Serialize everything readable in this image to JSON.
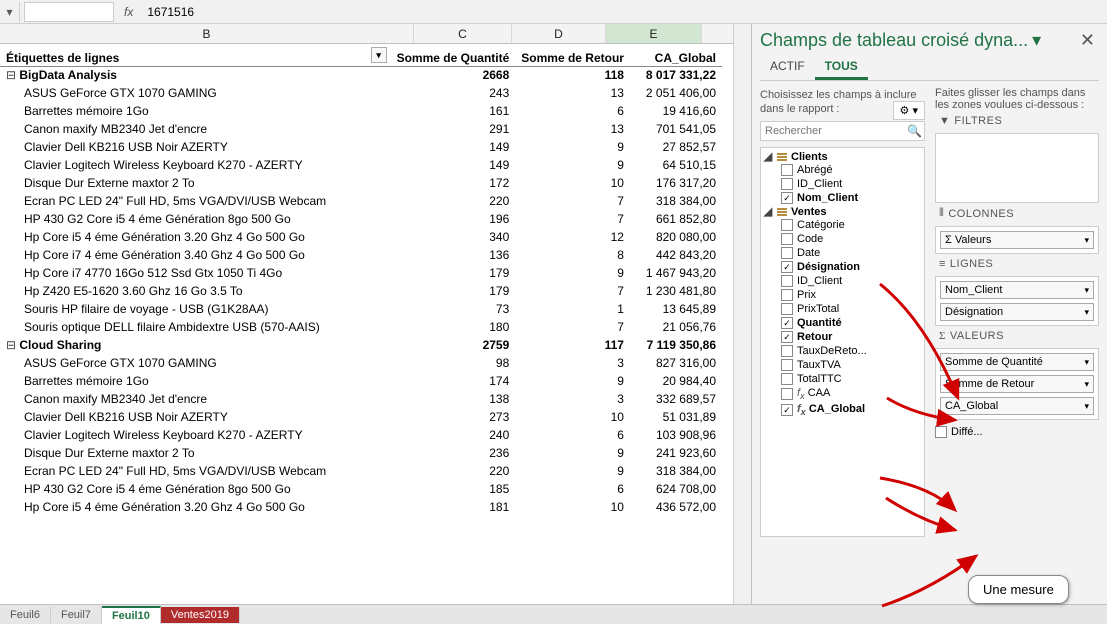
{
  "formula_bar": {
    "cell_ref": "",
    "fx_symbol": "fx",
    "value": "1671516"
  },
  "columns": [
    "B",
    "C",
    "D",
    "E"
  ],
  "headers": {
    "row_labels": "Étiquettes de lignes",
    "c": "Somme de Quantité",
    "d": "Somme de Retour",
    "e": "CA_Global"
  },
  "groups": [
    {
      "label": "BigData Analysis",
      "c": "2668",
      "d": "118",
      "e": "8 017 331,22",
      "rows": [
        {
          "label": "ASUS GeForce GTX 1070 GAMING",
          "c": "243",
          "d": "13",
          "e": "2 051 406,00"
        },
        {
          "label": "Barrettes mémoire 1Go",
          "c": "161",
          "d": "6",
          "e": "19 416,60"
        },
        {
          "label": "Canon maxify MB2340 Jet d'encre",
          "c": "291",
          "d": "13",
          "e": "701 541,05"
        },
        {
          "label": "Clavier Dell KB216 USB Noir AZERTY",
          "c": "149",
          "d": "9",
          "e": "27 852,57"
        },
        {
          "label": "Clavier Logitech Wireless Keyboard K270 - AZERTY",
          "c": "149",
          "d": "9",
          "e": "64 510,15"
        },
        {
          "label": "Disque Dur Externe maxtor 2 To",
          "c": "172",
          "d": "10",
          "e": "176 317,20"
        },
        {
          "label": "Ecran PC LED 24\" Full HD, 5ms VGA/DVI/USB Webcam",
          "c": "220",
          "d": "7",
          "e": "318 384,00"
        },
        {
          "label": "HP 430 G2 Core i5 4 éme Génération 8go 500 Go",
          "c": "196",
          "d": "7",
          "e": "661 852,80"
        },
        {
          "label": "Hp Core i5 4 éme Génération 3.20 Ghz 4 Go 500 Go",
          "c": "340",
          "d": "12",
          "e": "820 080,00"
        },
        {
          "label": "Hp Core i7 4 éme Génération 3.40 Ghz 4 Go 500 Go",
          "c": "136",
          "d": "8",
          "e": "442 843,20"
        },
        {
          "label": "Hp Core i7 4770 16Go 512 Ssd Gtx 1050 Ti 4Go",
          "c": "179",
          "d": "9",
          "e": "1 467 943,20"
        },
        {
          "label": "Hp Z420 E5-1620 3.60 Ghz 16 Go 3.5 To",
          "c": "179",
          "d": "7",
          "e": "1 230 481,80"
        },
        {
          "label": "Souris HP filaire de voyage - USB (G1K28AA)",
          "c": "73",
          "d": "1",
          "e": "13 645,89"
        },
        {
          "label": "Souris optique DELL filaire Ambidextre USB (570-AAIS)",
          "c": "180",
          "d": "7",
          "e": "21 056,76"
        }
      ]
    },
    {
      "label": "Cloud Sharing",
      "c": "2759",
      "d": "117",
      "e": "7 119 350,86",
      "rows": [
        {
          "label": "ASUS GeForce GTX 1070 GAMING",
          "c": "98",
          "d": "3",
          "e": "827 316,00"
        },
        {
          "label": "Barrettes mémoire 1Go",
          "c": "174",
          "d": "9",
          "e": "20 984,40"
        },
        {
          "label": "Canon maxify MB2340 Jet d'encre",
          "c": "138",
          "d": "3",
          "e": "332 689,57"
        },
        {
          "label": "Clavier Dell KB216 USB Noir AZERTY",
          "c": "273",
          "d": "10",
          "e": "51 031,89"
        },
        {
          "label": "Clavier Logitech Wireless Keyboard K270 - AZERTY",
          "c": "240",
          "d": "6",
          "e": "103 908,96"
        },
        {
          "label": "Disque Dur Externe maxtor 2 To",
          "c": "236",
          "d": "9",
          "e": "241 923,60"
        },
        {
          "label": "Ecran PC LED 24\" Full HD, 5ms VGA/DVI/USB Webcam",
          "c": "220",
          "d": "9",
          "e": "318 384,00"
        },
        {
          "label": "HP 430 G2 Core i5 4 éme Génération 8go 500 Go",
          "c": "185",
          "d": "6",
          "e": "624 708,00"
        },
        {
          "label": "Hp Core i5 4 éme Génération 3.20 Ghz 4 Go 500 Go",
          "c": "181",
          "d": "10",
          "e": "436 572,00"
        }
      ]
    }
  ],
  "sheet_tabs": [
    {
      "label": "Feuil6",
      "active": false
    },
    {
      "label": "Feuil7",
      "active": false
    },
    {
      "label": "Feuil10",
      "active": true
    },
    {
      "label": "Ventes2019",
      "active": false,
      "red": true
    }
  ],
  "panel": {
    "title": "Champs de tableau croisé dyna...",
    "actif": "ACTIF",
    "tous": "TOUS",
    "instr": "Choisissez les champs à inclure dans le rapport :",
    "drag_instr": "Faites glisser les champs dans les zones voulues ci-dessous :",
    "search_placeholder": "Rechercher",
    "tables": [
      {
        "name": "Clients",
        "items": [
          {
            "label": "Abrégé",
            "checked": false
          },
          {
            "label": "ID_Client",
            "checked": false
          },
          {
            "label": "Nom_Client",
            "checked": true
          }
        ]
      },
      {
        "name": "Ventes",
        "items": [
          {
            "label": "Catégorie",
            "checked": false
          },
          {
            "label": "Code",
            "checked": false
          },
          {
            "label": "Date",
            "checked": false
          },
          {
            "label": "Désignation",
            "checked": true
          },
          {
            "label": "ID_Client",
            "checked": false
          },
          {
            "label": "Prix",
            "checked": false
          },
          {
            "label": "PrixTotal",
            "checked": false
          },
          {
            "label": "Quantité",
            "checked": true
          },
          {
            "label": "Retour",
            "checked": true
          },
          {
            "label": "TauxDeReto...",
            "checked": false
          },
          {
            "label": "TauxTVA",
            "checked": false
          },
          {
            "label": "TotalTTC",
            "checked": false
          },
          {
            "label": "fx CAA",
            "checked": false,
            "fx": true
          },
          {
            "label": "fx CA_Global",
            "checked": true,
            "fx": true
          }
        ]
      }
    ],
    "zones": {
      "filtres": "FILTRES",
      "colonnes": "COLONNES",
      "col_items": [
        "Σ Valeurs"
      ],
      "lignes": "LIGNES",
      "row_items": [
        "Nom_Client",
        "Désignation"
      ],
      "valeurs": "VALEURS",
      "val_items": [
        "Somme de Quantité",
        "Somme de Retour",
        "CA_Global"
      ]
    },
    "defer": "Diffé..."
  },
  "callout": "Une mesure"
}
